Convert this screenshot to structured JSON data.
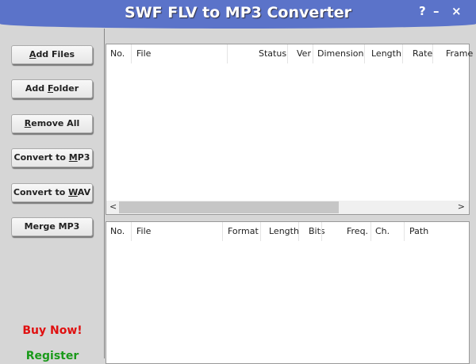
{
  "window": {
    "title": "SWF FLV to MP3 Converter",
    "help": "?",
    "minimize": "–",
    "close": "×"
  },
  "buttons": [
    {
      "pre": "",
      "key": "A",
      "post": "dd Files"
    },
    {
      "pre": "Add ",
      "key": "F",
      "post": "older"
    },
    {
      "pre": "",
      "key": "R",
      "post": "emove All"
    },
    {
      "pre": "Convert to ",
      "key": "M",
      "post": "P3"
    },
    {
      "pre": "Convert to ",
      "key": "W",
      "post": "AV"
    },
    {
      "pre": "Merge MP3",
      "key": "",
      "post": ""
    }
  ],
  "links": {
    "buy": "Buy Now!",
    "register": "Register"
  },
  "colors": {
    "buy": "#e01010",
    "register": "#1a9a1a",
    "titlebar": "#5b73c9"
  },
  "upper_list": {
    "columns": [
      "No.",
      "File",
      "Status",
      "Ver",
      "Dimension",
      "Length",
      "Rate",
      "Frame"
    ],
    "scroll_left": "<",
    "scroll_right": ">"
  },
  "lower_list": {
    "columns": [
      "No.",
      "File",
      "Format",
      "Length",
      "Bits",
      "Freq.",
      "Ch.",
      "Path"
    ]
  }
}
